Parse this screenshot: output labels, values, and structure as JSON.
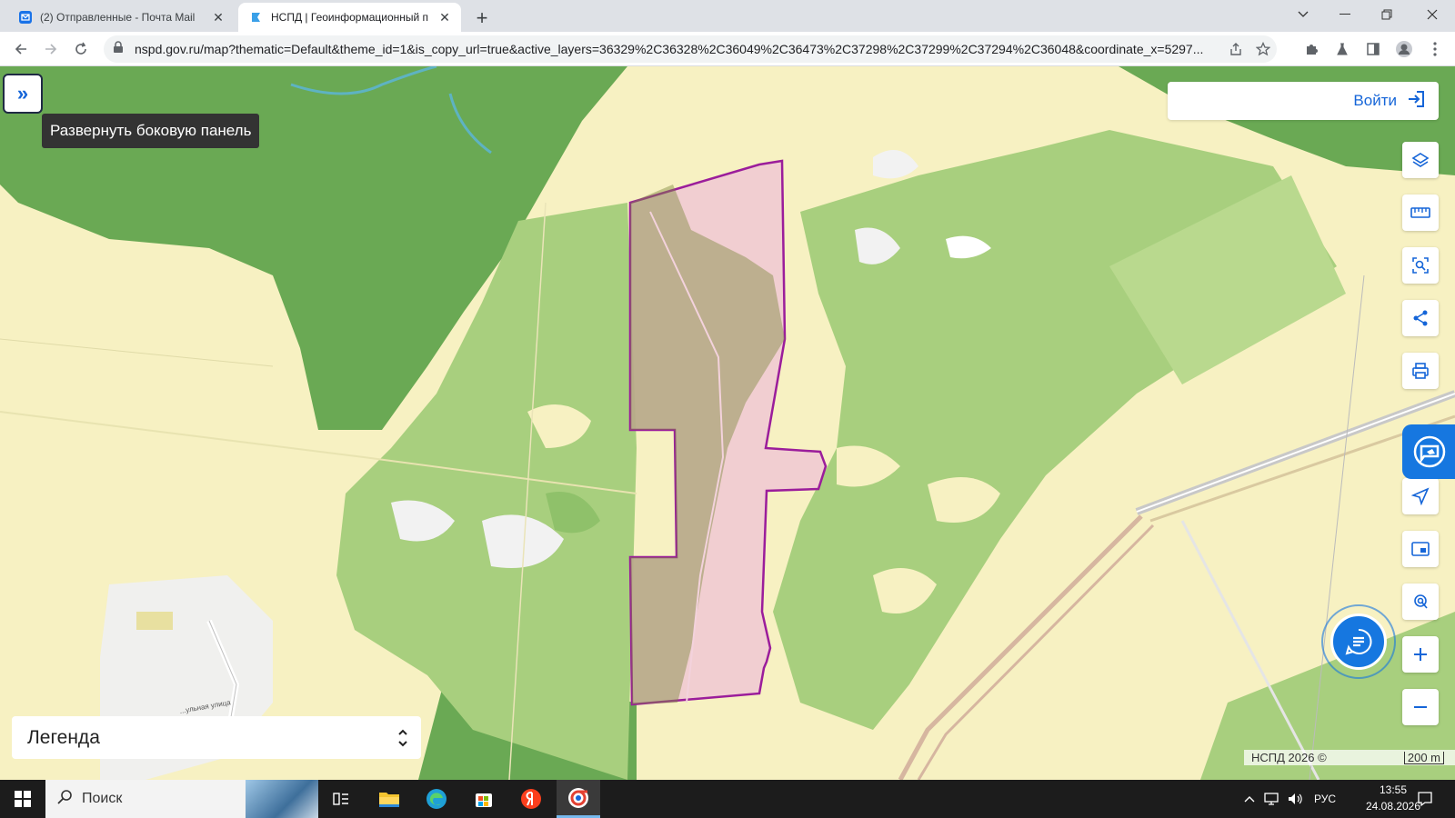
{
  "browser": {
    "tabs": [
      {
        "title": "(2) Отправленные - Почта Mail",
        "favicon": "mail-icon",
        "active": false
      },
      {
        "title": "НСПД | Геоинформационный п",
        "favicon": "nspd-icon",
        "active": true
      }
    ],
    "url": "nspd.gov.ru/map?thematic=Default&theme_id=1&is_copy_url=true&active_layers=36329%2C36328%2C36049%2C36473%2C37298%2C37299%2C37294%2C36048&coordinate_x=5297..."
  },
  "map": {
    "sidebar_tooltip": "Развернуть боковую панель",
    "login_label": "Войти",
    "legend_label": "Легенда",
    "attribution": "НСПД 2026 ©",
    "scale_label": "200 m",
    "street_label": "...ульная улица",
    "tools": [
      "layers-icon",
      "ruler-icon",
      "area-select-icon",
      "share-icon",
      "print-icon",
      "navigate-icon",
      "picture-in-picture-icon",
      "locate-icon",
      "zoom-in-icon",
      "zoom-out-icon"
    ],
    "colors": {
      "parcel_fill": "#f0c8d4",
      "parcel_border": "#9b1d9b",
      "forest_dark": "#6aa954",
      "forest_light": "#a8cf7e",
      "field": "#f7f1c2",
      "accent": "#1677e0"
    }
  },
  "taskbar": {
    "search_label": "Поиск",
    "language": "РУС",
    "time": "13:55",
    "date": "24.08.2026"
  }
}
